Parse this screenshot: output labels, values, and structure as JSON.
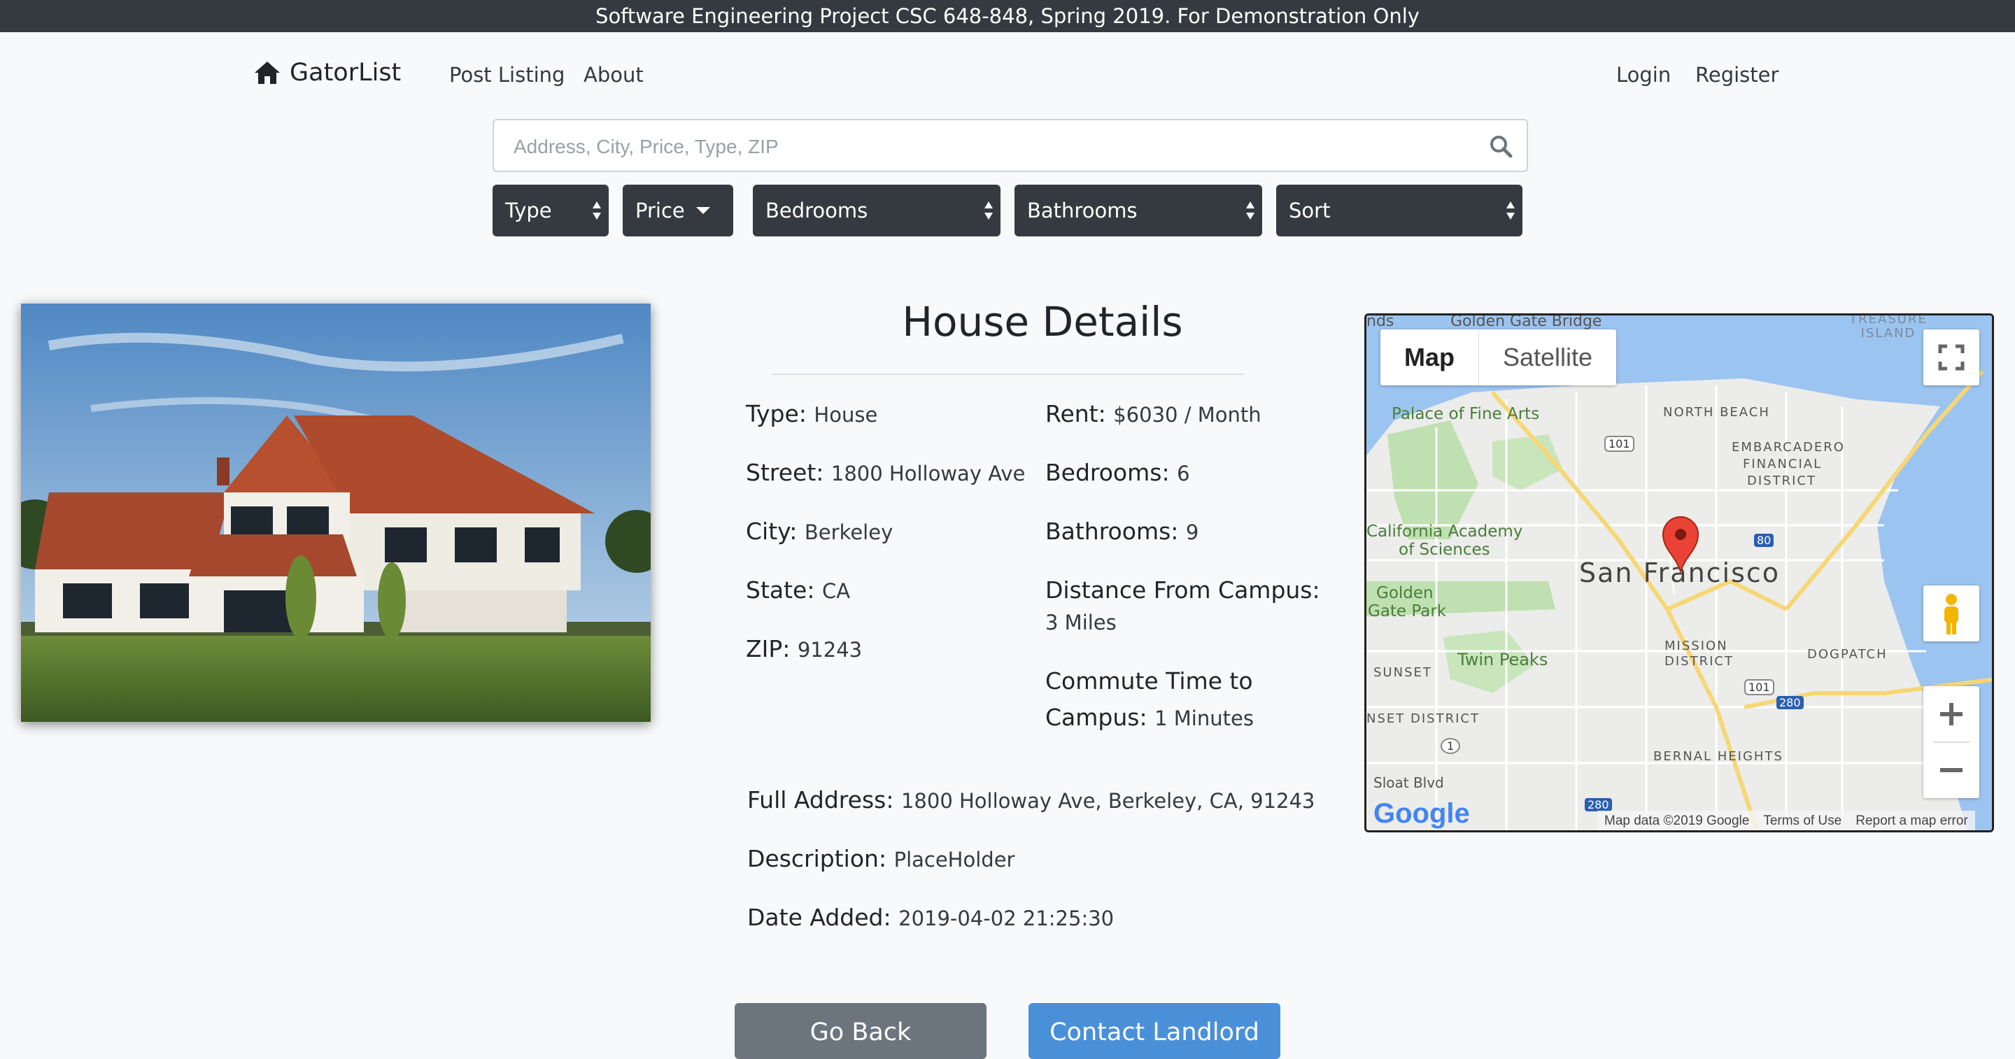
{
  "banner": "Software Engineering Project CSC 648-848, Spring 2019. For Demonstration Only",
  "nav": {
    "brand": "GatorList",
    "post_listing": "Post Listing",
    "about": "About",
    "login": "Login",
    "register": "Register"
  },
  "search": {
    "placeholder": "Address, City, Price, Type, ZIP"
  },
  "filters": {
    "type": "Type",
    "price": "Price",
    "bedrooms": "Bedrooms",
    "bathrooms": "Bathrooms",
    "sort": "Sort"
  },
  "details": {
    "title": "House Details",
    "type_label": "Type:",
    "type_value": "House",
    "street_label": "Street:",
    "street_value": "1800 Holloway Ave",
    "city_label": "City:",
    "city_value": "Berkeley",
    "state_label": "State:",
    "state_value": "CA",
    "zip_label": "ZIP:",
    "zip_value": "91243",
    "rent_label": "Rent:",
    "rent_value": "$6030 / Month",
    "bedrooms_label": "Bedrooms:",
    "bedrooms_value": "6",
    "bathrooms_label": "Bathrooms:",
    "bathrooms_value": "9",
    "distance_label": "Distance From Campus:",
    "distance_value": "3 Miles",
    "commute_label_1": "Commute Time to",
    "commute_label_2": "Campus:",
    "commute_value": "1 Minutes",
    "full_address_label": "Full Address:",
    "full_address_value": "1800 Holloway Ave, Berkeley, CA, 91243",
    "description_label": "Description:",
    "description_value": "PlaceHolder",
    "date_label": "Date Added:",
    "date_value": "2019-04-02 21:25:30"
  },
  "map": {
    "map_btn": "Map",
    "satellite_btn": "Satellite",
    "labels": {
      "golden_gate_bridge": "Golden Gate Bridge",
      "treasure_island": "TREASURE ISLAND",
      "palace": "Palace of Fine Arts",
      "north_beach": "NORTH BEACH",
      "embarcadero": "EMBARCADERO",
      "financial": "FINANCIAL",
      "district": "DISTRICT",
      "academy_1": "California Academy",
      "academy_2": "of Sciences",
      "sf": "San Francisco",
      "ggpark_1": "Golden",
      "ggpark_2": "Gate Park",
      "sunset": "SUNSET",
      "twin_peaks": "Twin Peaks",
      "mission": "MISSION",
      "mission_district": "DISTRICT",
      "dogpatch": "DOGPATCH",
      "sunset_district": "NSET DISTRICT",
      "bernal": "BERNAL HEIGHTS",
      "sloat": "Sloat Blvd",
      "rt101a": "101",
      "rt101b": "101",
      "rt80": "80",
      "rt280a": "280",
      "rt280b": "280",
      "rt1": "1",
      "lands": "nds"
    },
    "google": "Google",
    "attribution": "Map data ©2019 Google",
    "terms": "Terms of Use",
    "report": "Report a map error"
  },
  "buttons": {
    "go_back": "Go Back",
    "contact": "Contact Landlord"
  },
  "colors": {
    "dark": "#343a40",
    "primary": "#4a90d9",
    "secondary": "#6c757d"
  }
}
